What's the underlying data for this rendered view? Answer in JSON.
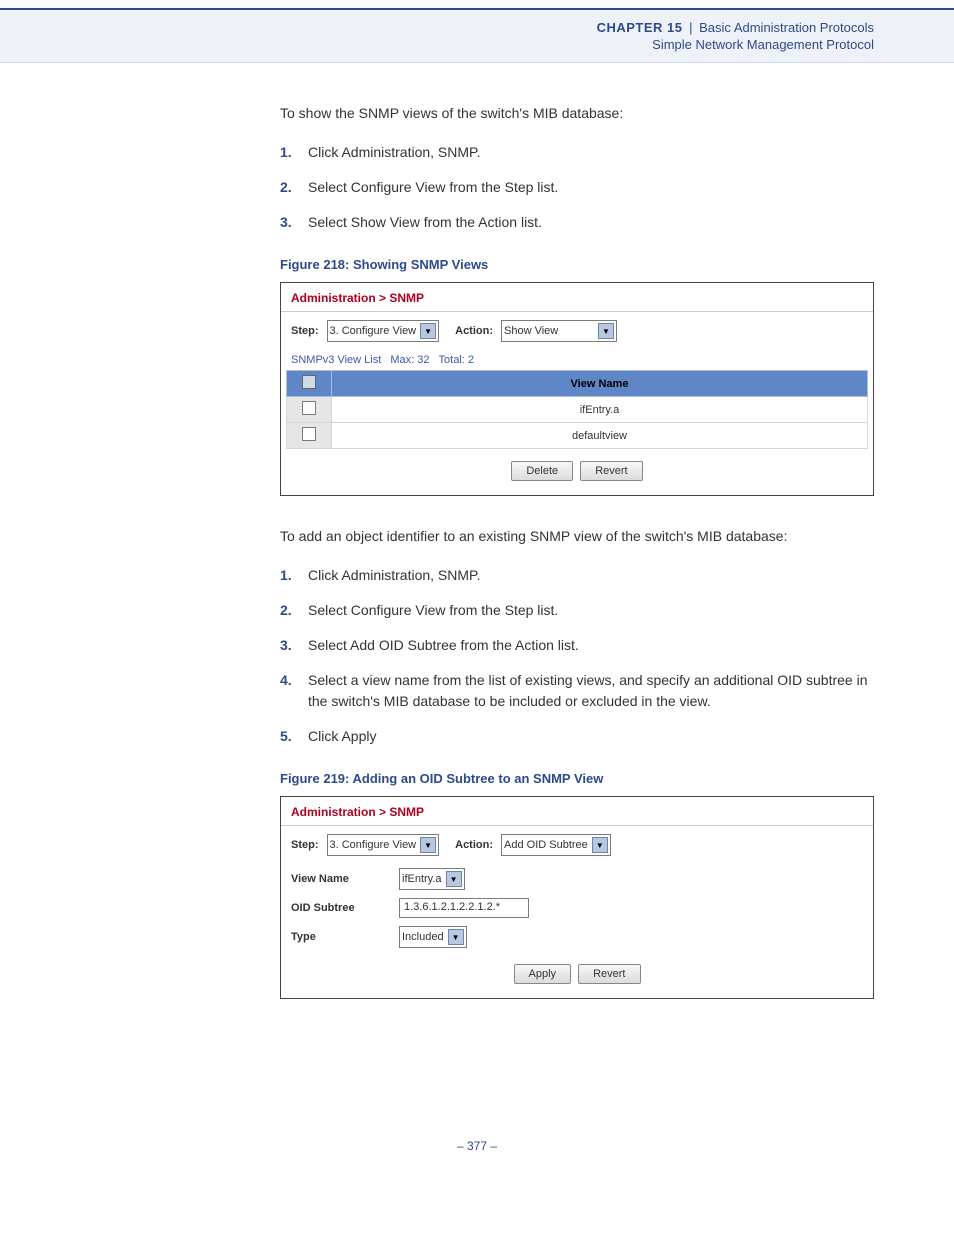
{
  "header": {
    "chapter": "CHAPTER 15",
    "title": "Basic Administration Protocols",
    "subtitle": "Simple Network Management Protocol"
  },
  "section1": {
    "intro": "To show the SNMP views of the switch's MIB database:",
    "steps": [
      "Click Administration, SNMP.",
      "Select Configure View from the Step list.",
      "Select Show View from the Action list."
    ],
    "caption": "Figure 218:  Showing SNMP Views"
  },
  "fig218": {
    "breadcrumb": "Administration > SNMP",
    "step_label": "Step:",
    "step_value": "3. Configure View",
    "action_label": "Action:",
    "action_value": "Show View",
    "list_label": "SNMPv3 View List",
    "max_label": "Max: 32",
    "total_label": "Total: 2",
    "header_viewname": "View Name",
    "rows": [
      {
        "name": "ifEntry.a"
      },
      {
        "name": "defaultview"
      }
    ],
    "btn_delete": "Delete",
    "btn_revert": "Revert"
  },
  "section2": {
    "intro": "To add an object identifier to an existing SNMP view of the switch's MIB database:",
    "steps": [
      "Click Administration, SNMP.",
      "Select Configure View from the Step list.",
      "Select Add OID Subtree from the Action list.",
      "Select a view name from the list of existing views, and specify an additional OID subtree in the switch's MIB database to be included or excluded in the view.",
      "Click Apply"
    ],
    "caption": "Figure 219:  Adding an OID Subtree to an SNMP View"
  },
  "fig219": {
    "breadcrumb": "Administration > SNMP",
    "step_label": "Step:",
    "step_value": "3. Configure View",
    "action_label": "Action:",
    "action_value": "Add OID Subtree",
    "viewname_label": "View Name",
    "viewname_value": "ifEntry.a",
    "oid_label": "OID Subtree",
    "oid_value": "1.3.6.1.2.1.2.2.1.2.*",
    "type_label": "Type",
    "type_value": "Included",
    "btn_apply": "Apply",
    "btn_revert": "Revert"
  },
  "page_number": "–  377  –"
}
